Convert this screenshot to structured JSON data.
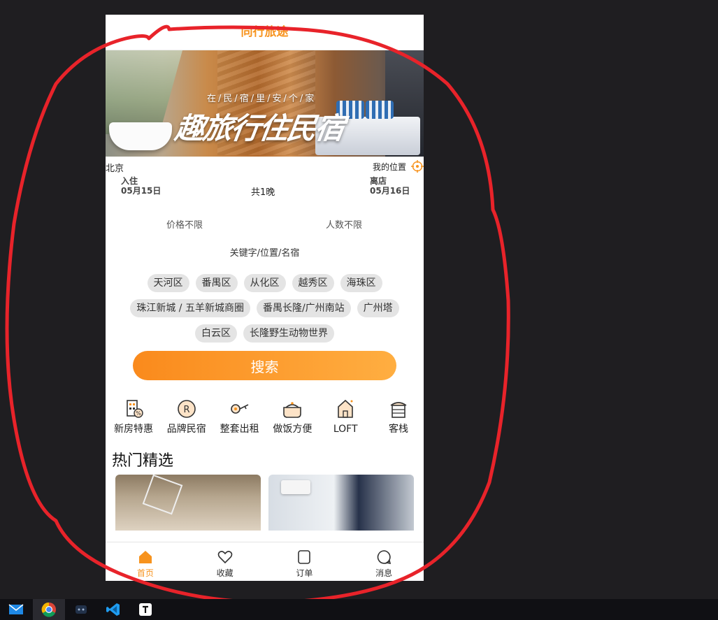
{
  "app": {
    "title": "同行旅途"
  },
  "banner": {
    "tagline": "在/民/宿/里/安/个/家",
    "headline": "趣旅行住民宿"
  },
  "location": {
    "city": "北京",
    "my_location": "我的位置"
  },
  "dates": {
    "checkin_label": "入住",
    "checkin_date": "05月15日",
    "nights": "共1晚",
    "checkout_label": "离店",
    "checkout_date": "05月16日"
  },
  "filters": {
    "price": "价格不限",
    "people": "人数不限"
  },
  "keyword": "关键字/位置/名宿",
  "tags": [
    "天河区",
    "番禺区",
    "从化区",
    "越秀区",
    "海珠区",
    "珠江新城 / 五羊新城商圈",
    "番禺长隆/广州南站",
    "广州塔",
    "白云区",
    "长隆野生动物世界"
  ],
  "search_button": "搜索",
  "categories": [
    {
      "label": "新房特惠",
      "icon": "new-house-icon"
    },
    {
      "label": "品牌民宿",
      "icon": "brand-icon"
    },
    {
      "label": "整套出租",
      "icon": "key-icon"
    },
    {
      "label": "做饭方便",
      "icon": "pot-icon"
    },
    {
      "label": "LOFT",
      "icon": "loft-icon"
    },
    {
      "label": "客栈",
      "icon": "inn-icon"
    }
  ],
  "hot": {
    "title": "热门精选"
  },
  "tabbar": [
    {
      "label": "首页",
      "icon": "home-icon",
      "active": true
    },
    {
      "label": "收藏",
      "icon": "heart-icon",
      "active": false
    },
    {
      "label": "订单",
      "icon": "order-icon",
      "active": false
    },
    {
      "label": "消息",
      "icon": "message-icon",
      "active": false
    }
  ],
  "colors": {
    "accent": "#f7931e",
    "annotation": "#e8232a",
    "desktop": "#1f1e21"
  },
  "taskbar": {
    "apps": [
      "mail-icon",
      "chrome-icon",
      "app-icon",
      "vscode-icon",
      "typora-icon"
    ]
  }
}
